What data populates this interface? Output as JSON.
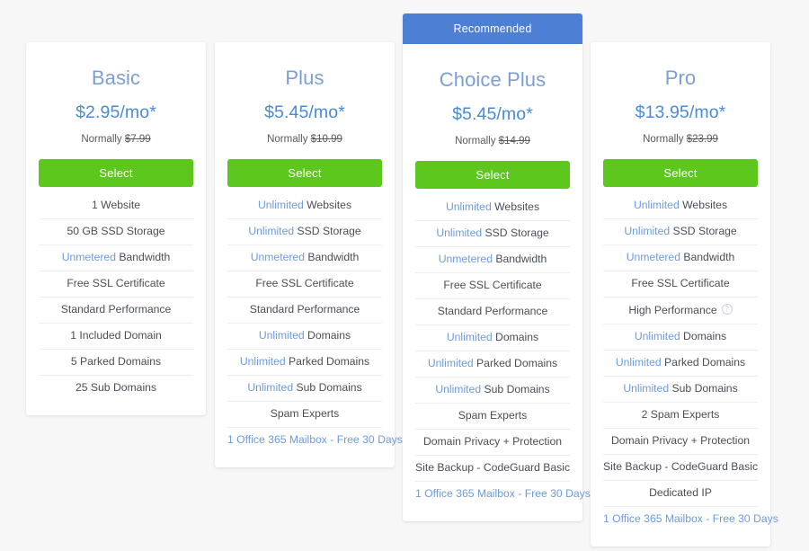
{
  "plans": [
    {
      "id": "basic",
      "name": "Basic",
      "price": "$2.95/mo*",
      "normally_label": "Normally",
      "normally_price": "$7.99",
      "select_label": "Select",
      "ribbon": null,
      "features": [
        {
          "highlight": "",
          "text": "1 Website",
          "link": false,
          "info": false
        },
        {
          "highlight": "",
          "text": "50 GB SSD Storage",
          "link": false,
          "info": false
        },
        {
          "highlight": "Unmetered",
          "text": " Bandwidth",
          "link": false,
          "info": false
        },
        {
          "highlight": "",
          "text": "Free SSL Certificate",
          "link": false,
          "info": false
        },
        {
          "highlight": "",
          "text": "Standard Performance",
          "link": false,
          "info": false
        },
        {
          "highlight": "",
          "text": "1 Included Domain",
          "link": false,
          "info": false
        },
        {
          "highlight": "",
          "text": "5 Parked Domains",
          "link": false,
          "info": false
        },
        {
          "highlight": "",
          "text": "25 Sub Domains",
          "link": false,
          "info": false
        }
      ]
    },
    {
      "id": "plus",
      "name": "Plus",
      "price": "$5.45/mo*",
      "normally_label": "Normally",
      "normally_price": "$10.99",
      "select_label": "Select",
      "ribbon": null,
      "features": [
        {
          "highlight": "Unlimited",
          "text": " Websites",
          "link": false,
          "info": false
        },
        {
          "highlight": "Unlimited",
          "text": " SSD Storage",
          "link": false,
          "info": false
        },
        {
          "highlight": "Unmetered",
          "text": " Bandwidth",
          "link": false,
          "info": false
        },
        {
          "highlight": "",
          "text": "Free SSL Certificate",
          "link": false,
          "info": false
        },
        {
          "highlight": "",
          "text": "Standard Performance",
          "link": false,
          "info": false
        },
        {
          "highlight": "Unlimited",
          "text": " Domains",
          "link": false,
          "info": false
        },
        {
          "highlight": "Unlimited",
          "text": " Parked Domains",
          "link": false,
          "info": false
        },
        {
          "highlight": "Unlimited",
          "text": " Sub Domains",
          "link": false,
          "info": false
        },
        {
          "highlight": "",
          "text": "Spam Experts",
          "link": false,
          "info": false
        },
        {
          "highlight": "",
          "text": "1 Office 365 Mailbox - Free 30 Days",
          "link": true,
          "info": false
        }
      ]
    },
    {
      "id": "choiceplus",
      "name": "Choice Plus",
      "price": "$5.45/mo*",
      "normally_label": "Normally",
      "normally_price": "$14.99",
      "select_label": "Select",
      "ribbon": "Recommended",
      "features": [
        {
          "highlight": "Unlimited",
          "text": " Websites",
          "link": false,
          "info": false
        },
        {
          "highlight": "Unlimited",
          "text": " SSD Storage",
          "link": false,
          "info": false
        },
        {
          "highlight": "Unmetered",
          "text": " Bandwidth",
          "link": false,
          "info": false
        },
        {
          "highlight": "",
          "text": "Free SSL Certificate",
          "link": false,
          "info": false
        },
        {
          "highlight": "",
          "text": "Standard Performance",
          "link": false,
          "info": false
        },
        {
          "highlight": "Unlimited",
          "text": " Domains",
          "link": false,
          "info": false
        },
        {
          "highlight": "Unlimited",
          "text": " Parked Domains",
          "link": false,
          "info": false
        },
        {
          "highlight": "Unlimited",
          "text": " Sub Domains",
          "link": false,
          "info": false
        },
        {
          "highlight": "",
          "text": "Spam Experts",
          "link": false,
          "info": false
        },
        {
          "highlight": "",
          "text": "Domain Privacy + Protection",
          "link": false,
          "info": false
        },
        {
          "highlight": "",
          "text": "Site Backup - CodeGuard Basic",
          "link": false,
          "info": false
        },
        {
          "highlight": "",
          "text": "1 Office 365 Mailbox - Free 30 Days",
          "link": true,
          "info": false
        }
      ]
    },
    {
      "id": "pro",
      "name": "Pro",
      "price": "$13.95/mo*",
      "normally_label": "Normally",
      "normally_price": "$23.99",
      "select_label": "Select",
      "ribbon": null,
      "features": [
        {
          "highlight": "Unlimited",
          "text": " Websites",
          "link": false,
          "info": false
        },
        {
          "highlight": "Unlimited",
          "text": " SSD Storage",
          "link": false,
          "info": false
        },
        {
          "highlight": "Unmetered",
          "text": " Bandwidth",
          "link": false,
          "info": false
        },
        {
          "highlight": "",
          "text": "Free SSL Certificate",
          "link": false,
          "info": false
        },
        {
          "highlight": "",
          "text": "High Performance",
          "link": false,
          "info": true
        },
        {
          "highlight": "Unlimited",
          "text": " Domains",
          "link": false,
          "info": false
        },
        {
          "highlight": "Unlimited",
          "text": " Parked Domains",
          "link": false,
          "info": false
        },
        {
          "highlight": "Unlimited",
          "text": " Sub Domains",
          "link": false,
          "info": false
        },
        {
          "highlight": "",
          "text": "2 Spam Experts",
          "link": false,
          "info": false
        },
        {
          "highlight": "",
          "text": "Domain Privacy + Protection",
          "link": false,
          "info": false
        },
        {
          "highlight": "",
          "text": "Site Backup - CodeGuard Basic",
          "link": false,
          "info": false
        },
        {
          "highlight": "",
          "text": "Dedicated IP",
          "link": false,
          "info": false
        },
        {
          "highlight": "",
          "text": "1 Office 365 Mailbox - Free 30 Days",
          "link": true,
          "info": false
        }
      ]
    }
  ],
  "colors": {
    "page_background": "#f7f7f8",
    "card_background": "#ffffff",
    "ribbon_blue": "#4d7fd4",
    "plan_name_blue": "#7b9fd4",
    "price_blue": "#4a8bd6",
    "select_green": "#5dc71e",
    "highlight_blue": "#6d9bdc",
    "feature_text": "#4a4f55",
    "divider": "#eceef0"
  }
}
